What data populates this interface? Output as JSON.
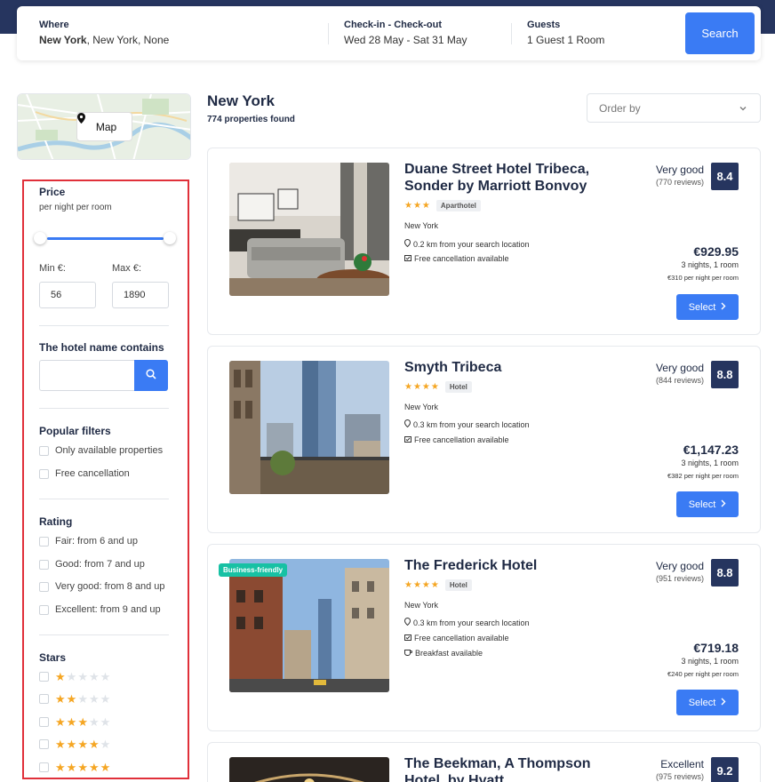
{
  "search": {
    "where_label": "Where",
    "where_city": "New York",
    "where_rest": ", New York, None",
    "dates_label": "Check-in - Check-out",
    "dates_value": "Wed 28 May - Sat 31 May",
    "guests_label": "Guests",
    "guests_value": "1 Guest 1 Room",
    "button": "Search"
  },
  "map": {
    "button": "Map"
  },
  "filters": {
    "price_title": "Price",
    "price_sub": "per night per room",
    "min_label": "Min €:",
    "max_label": "Max €:",
    "min_value": "56",
    "max_value": "1890",
    "name_title": "The hotel name contains",
    "name_value": "",
    "popular_title": "Popular filters",
    "popular": [
      "Only available properties",
      "Free cancellation"
    ],
    "rating_title": "Rating",
    "rating": [
      "Fair: from 6 and up",
      "Good: from 7 and up",
      "Very good: from 8 and up",
      "Excellent: from 9 and up"
    ],
    "stars_title": "Stars",
    "stars": [
      1,
      2,
      3,
      4,
      5
    ],
    "price_range_fraction": [
      0.0,
      1.0
    ]
  },
  "results": {
    "city": "New York",
    "found": "774 properties found",
    "order_by": "Order by"
  },
  "hotels": [
    {
      "name": "Duane Street Hotel Tribeca, Sonder by Marriott Bonvoy",
      "stars": "★★★",
      "type": "Aparthotel",
      "city": "New York",
      "distance": "0.2 km from your search location",
      "cancellation": "Free cancellation available",
      "review_label": "Very good",
      "review_count": "(770 reviews)",
      "score": "8.4",
      "price": "€929.95",
      "nights": "3 nights, 1 room",
      "per_night": "€310 per night per room",
      "select": "Select"
    },
    {
      "name": "Smyth Tribeca",
      "stars": "★★★★",
      "type": "Hotel",
      "city": "New York",
      "distance": "0.3 km from your search location",
      "cancellation": "Free cancellation available",
      "review_label": "Very good",
      "review_count": "(844 reviews)",
      "score": "8.8",
      "price": "€1,147.23",
      "nights": "3 nights, 1 room",
      "per_night": "€382 per night per room",
      "select": "Select"
    },
    {
      "name": "The Frederick Hotel",
      "badge": "Business-friendly",
      "stars": "★★★★",
      "type": "Hotel",
      "city": "New York",
      "distance": "0.3 km from your search location",
      "cancellation": "Free cancellation available",
      "breakfast": "Breakfast available",
      "review_label": "Very good",
      "review_count": "(951 reviews)",
      "score": "8.8",
      "price": "€719.18",
      "nights": "3 nights, 1 room",
      "per_night": "€240 per night per room",
      "select": "Select"
    },
    {
      "name": "The Beekman, A Thompson Hotel, by Hyatt",
      "review_label": "Excellent",
      "review_count": "(975 reviews)",
      "score": "9.2"
    }
  ],
  "colors": {
    "navy": "#26355f",
    "accent": "#3a7bf4",
    "star": "#f5a623",
    "badge": "#17c1a4",
    "highlight_border": "#e0303a"
  }
}
